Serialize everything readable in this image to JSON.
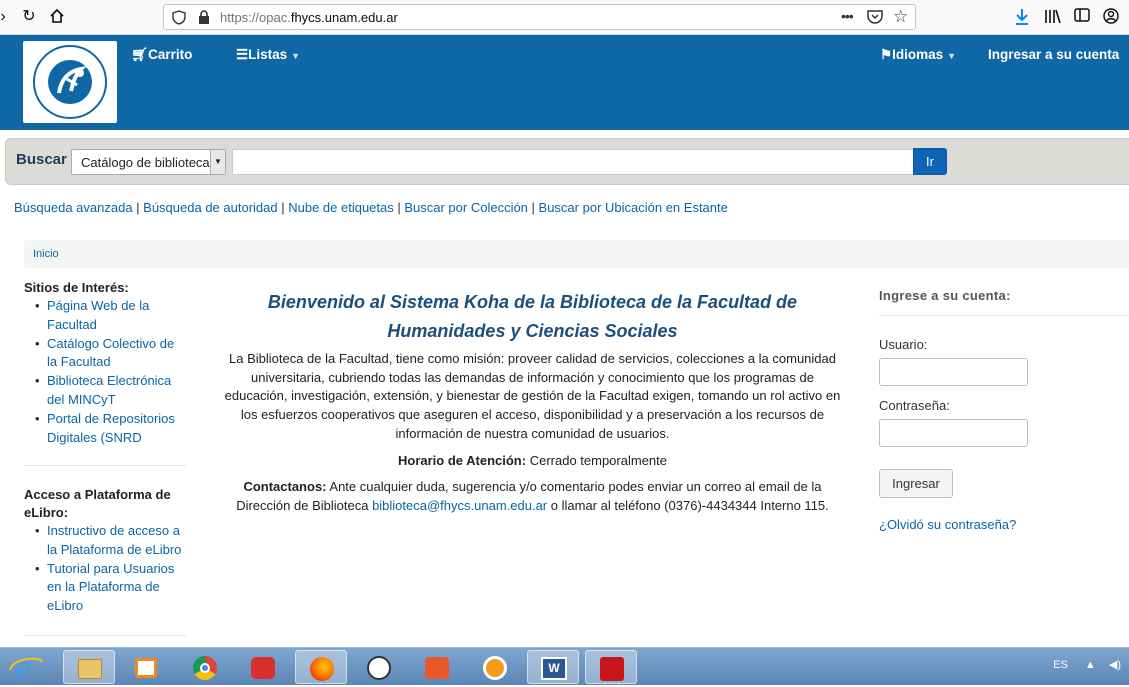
{
  "browser": {
    "url_prefix": "https://opac.",
    "url_domain": "fhycs.unam.edu.ar",
    "icons": [
      "back-icon",
      "reload-icon",
      "home-icon",
      "shield-icon",
      "lock-icon",
      "more-icon",
      "pocket-icon",
      "star-icon",
      "download-icon",
      "library-icon",
      "sidebar-icon",
      "account-icon"
    ]
  },
  "header": {
    "cart": "Carrito",
    "lists": "Listas",
    "languages": "Idiomas",
    "login": "Ingresar a su cuenta"
  },
  "search": {
    "label": "Buscar",
    "catalog": "Catálogo de biblioteca",
    "go": "Ir"
  },
  "moresearches": [
    "Búsqueda avanzada",
    "Búsqueda de autoridad",
    "Nube de etiquetas",
    "Buscar por Colección",
    "Buscar por Ubicación en Estante"
  ],
  "breadcrumb": "Inicio",
  "left": {
    "sites_title": "Sitios de Interés:",
    "sites": [
      [
        "Página Web de la",
        "Facultad"
      ],
      [
        "Catálogo Colectivo de",
        "la Facultad"
      ],
      [
        "Biblioteca Electrónica",
        "del MINCyT"
      ],
      [
        "Portal de Repositorios",
        "Digitales (SNRD"
      ]
    ],
    "elibro_title": [
      "Acceso a Plataforma de",
      "eLibro:"
    ],
    "elibro": [
      [
        "Instructivo de acceso a",
        "la Plataforma de eLibro"
      ],
      [
        "Tutorial para Usuarios",
        "en la Plataforma de",
        "eLibro"
      ]
    ]
  },
  "center": {
    "title1": "Bienvenido al Sistema Koha de la Biblioteca de la Facultad de",
    "title2": "Humanidades y Ciencias Sociales",
    "mission": [
      "La Biblioteca de la Facultad, tiene como misión: proveer calidad de servicios, colecciones a la comunidad",
      "universitaria, cubriendo todas las demandas de información y conocimiento que los programas de",
      "educación, investigación, extensión, y bienestar de gestión de la Facultad exigen, tomando un rol activo en",
      "los esfuerzos cooperativos que aseguren el acceso, disponibilidad y a preservación a los recursos de",
      "información de nuestra comunidad de usuarios."
    ],
    "hours_label": "Horario de Atención:",
    "hours_value": "Cerrado temporalmente",
    "contact_label": "Contactanos:",
    "contact_text1": "Ante cualquier duda, sugerencia y/o comentario podes enviar un correo al email de la",
    "contact_text2a": "Dirección de Biblioteca",
    "contact_email": "biblioteca@fhycs.unam.edu.ar",
    "contact_text2b": "o llamar al teléfono (0376)-4434344 Interno 115."
  },
  "login": {
    "title": "Ingrese a su cuenta:",
    "user_label": "Usuario:",
    "user_value": "",
    "pass_label": "Contraseña:",
    "pass_value": "",
    "button": "Ingresar",
    "forgot": "¿Olvidó su contraseña?"
  },
  "taskbar": {
    "apps": [
      "ie-icon",
      "explorer-icon",
      "media-icon",
      "chrome-icon",
      "app-icon",
      "firefox-icon",
      "clock-icon",
      "app2-icon",
      "shield-app-icon",
      "word-icon",
      "pdf-icon"
    ],
    "lang": "ES"
  }
}
